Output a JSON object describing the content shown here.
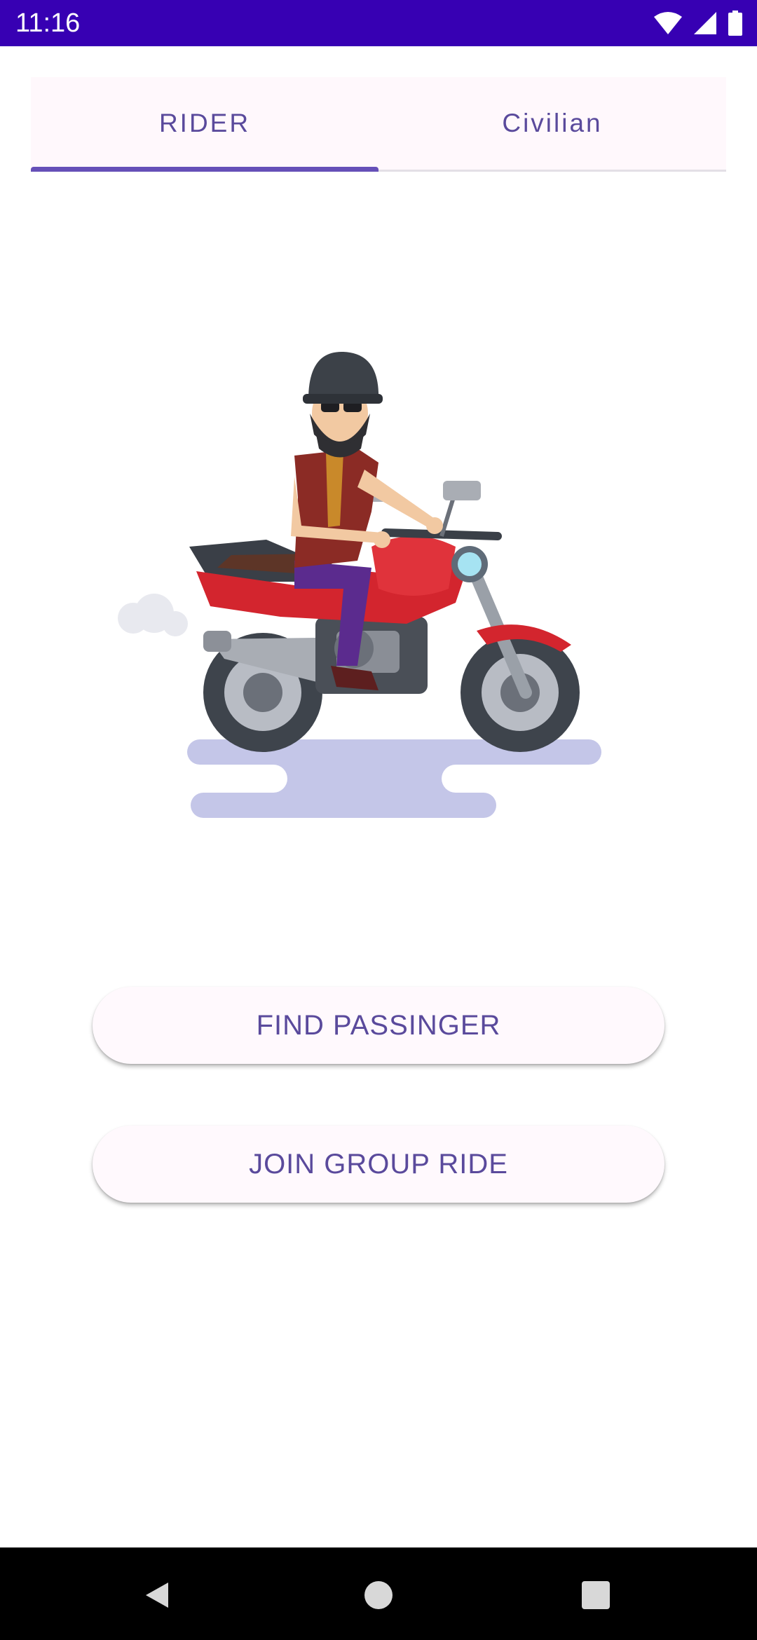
{
  "status_bar": {
    "time": "11:16",
    "icons": [
      "wifi-icon",
      "cell-signal-icon",
      "battery-icon"
    ],
    "background": "#3700b3"
  },
  "tabs": [
    {
      "label": "RIDER",
      "selected": true
    },
    {
      "label": "Civilian",
      "selected": false
    }
  ],
  "illustration": {
    "name": "motorcycle-rider-illustration"
  },
  "buttons": {
    "find_passenger": "FIND PASSINGER",
    "join_group_ride": "JOIN GROUP RIDE"
  },
  "colors": {
    "accent": "#6650b8",
    "text_primary": "#5a4a9c",
    "button_bg": "#fff9fd"
  },
  "nav_bar": {
    "icons": [
      "back-icon",
      "home-icon",
      "recents-icon"
    ]
  }
}
